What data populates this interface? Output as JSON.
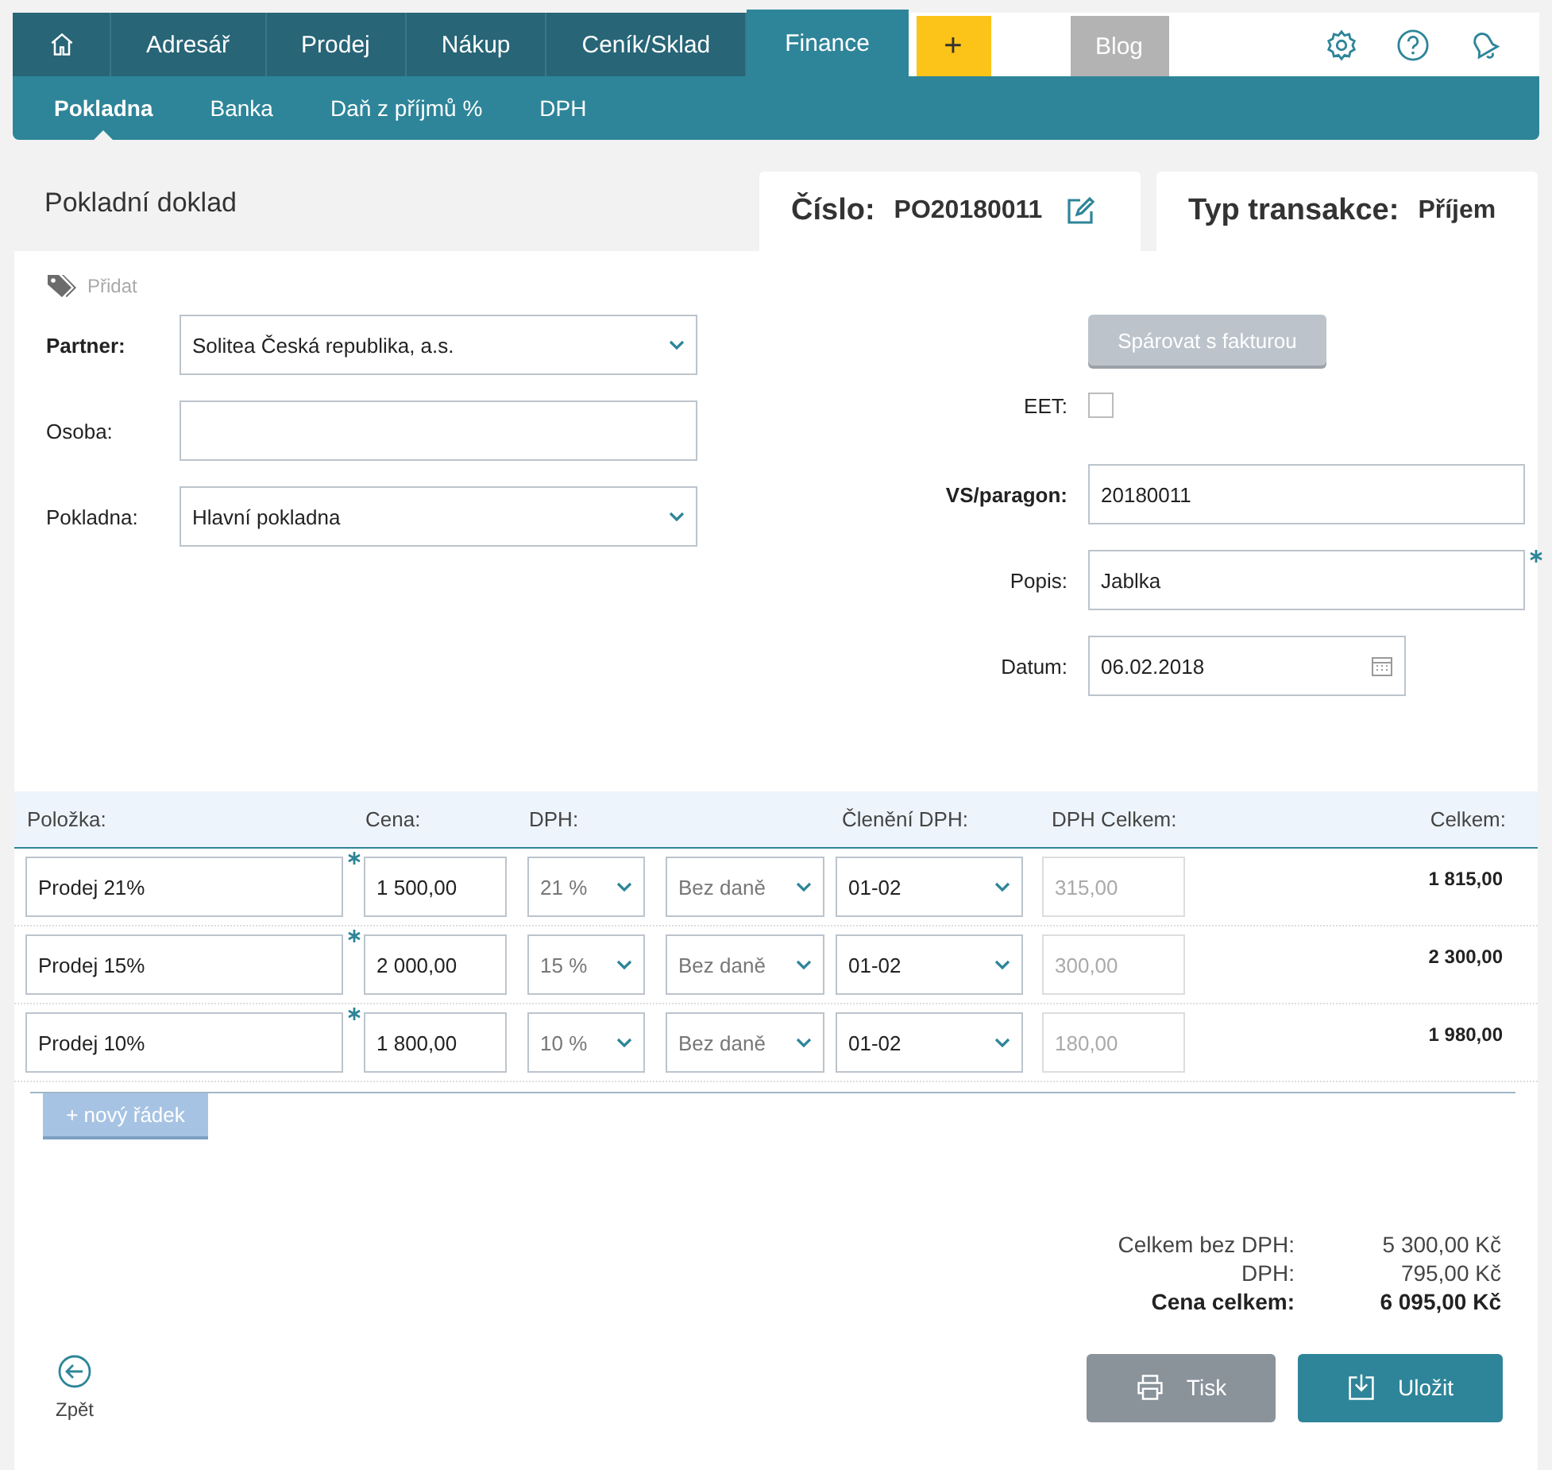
{
  "nav": {
    "tabs": [
      {
        "label": "Adresář",
        "selected": false
      },
      {
        "label": "Prodej",
        "selected": false
      },
      {
        "label": "Nákup",
        "selected": false
      },
      {
        "label": "Ceník/Sklad",
        "selected": false
      },
      {
        "label": "Finance",
        "selected": true
      }
    ],
    "plus": "+",
    "blog": "Blog"
  },
  "subtabs": [
    {
      "label": "Pokladna",
      "selected": true
    },
    {
      "label": "Banka",
      "selected": false
    },
    {
      "label": "Daň z příjmů %",
      "selected": false
    },
    {
      "label": "DPH",
      "selected": false
    }
  ],
  "doc": {
    "title": "Pokladní doklad",
    "number_label": "Číslo:",
    "number": "PO20180011",
    "type_label": "Typ transakce:",
    "type_value": "Příjem"
  },
  "tag_add": "Přidat",
  "left_fields": [
    {
      "label": "Partner:",
      "value": "Solitea Česká republika, a.s.",
      "kind": "select",
      "bold": true
    },
    {
      "label": "Osoba:",
      "kind": "input",
      "bold": false
    },
    {
      "label": "Pokladna:",
      "value": "Hlavní pokladna",
      "kind": "select",
      "bold": false
    }
  ],
  "pair_button": "Spárovat s fakturou",
  "eet": {
    "label": "EET:",
    "checked": false
  },
  "right_fields": [
    {
      "label": "VS/paragon:",
      "value": "20180011",
      "kind": "input",
      "bold": true,
      "required": false
    },
    {
      "label": "Popis:",
      "value": "Jablka",
      "kind": "input",
      "bold": false,
      "required": true
    },
    {
      "label": "Datum:",
      "value": "06.02.2018",
      "kind": "date",
      "bold": false,
      "required": false
    }
  ],
  "table": {
    "columns": [
      "Položka:",
      "Cena:",
      "DPH:",
      "Členění DPH:",
      "DPH Celkem:",
      "Celkem:"
    ],
    "rows": [
      {
        "item": "Prodej 21%",
        "required": true,
        "price": "1 500,00",
        "vat_rate": "21 %",
        "vat_mode": "Bez daně",
        "vat_split": "01-02",
        "vat_total": "315,00",
        "total": "1 815,00"
      },
      {
        "item": "Prodej 15%",
        "required": true,
        "price": "2 000,00",
        "vat_rate": "15 %",
        "vat_mode": "Bez daně",
        "vat_split": "01-02",
        "vat_total": "300,00",
        "total": "2 300,00"
      },
      {
        "item": "Prodej 10%",
        "required": true,
        "price": "1 800,00",
        "vat_rate": "10 %",
        "vat_mode": "Bez daně",
        "vat_split": "01-02",
        "vat_total": "180,00",
        "total": "1 980,00"
      }
    ]
  },
  "add_row": "+ nový řádek",
  "totals": [
    {
      "label": "Celkem bez DPH:",
      "value": "5 300,00 Kč",
      "emphasis": false
    },
    {
      "label": "DPH:",
      "value": "795,00 Kč",
      "emphasis": false
    },
    {
      "label": "Cena celkem:",
      "value": "6 095,00 Kč",
      "emphasis": true
    }
  ],
  "back": "Zpět",
  "print": "Tisk",
  "save": "Uložit"
}
